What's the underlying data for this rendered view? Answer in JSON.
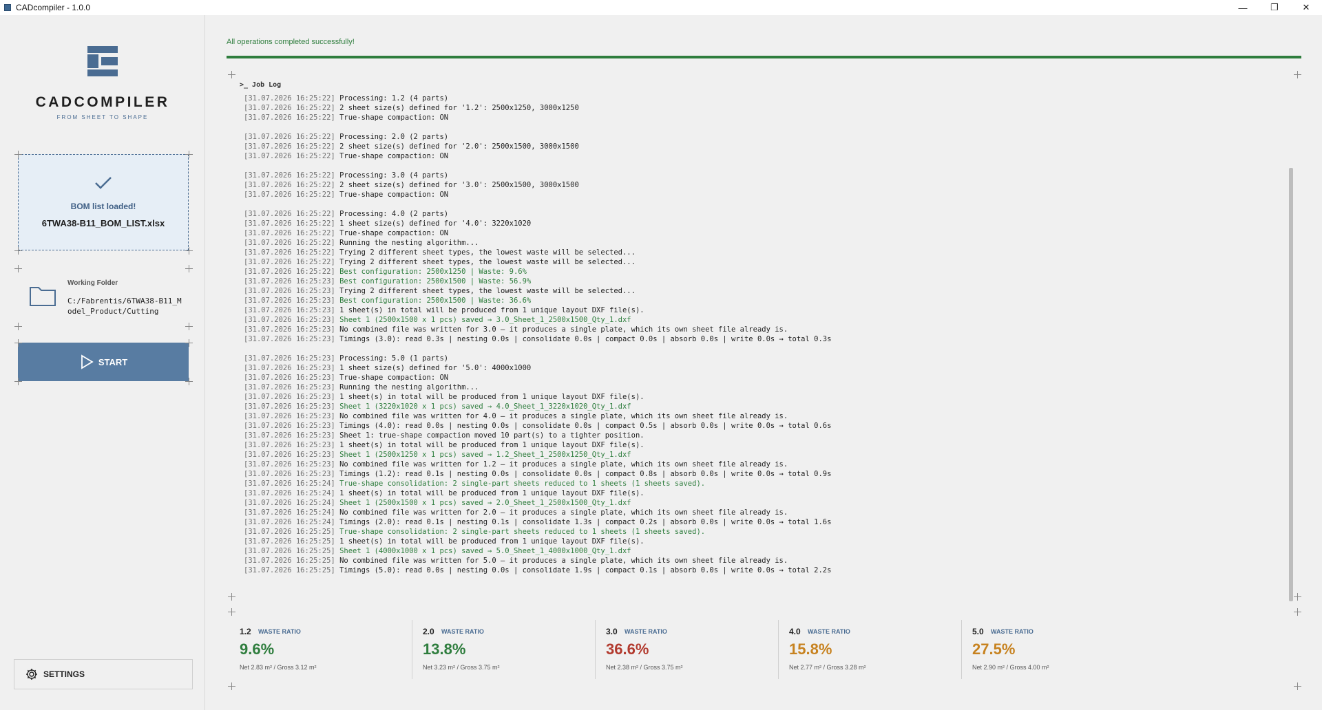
{
  "window": {
    "title": "CADcompiler - 1.0.0",
    "controls": [
      "—",
      "❐",
      "✕"
    ]
  },
  "sidebar": {
    "logo_name": "CADCOMPILER",
    "logo_tagline": "FROM SHEET TO SHAPE",
    "bom_status": "BOM list loaded!",
    "bom_file": "6TWA38-B11_BOM_LIST.xlsx",
    "folder_label": "Working Folder",
    "folder_path": "C:/Fabrentis/6TWA38-B11_Model_Product/Cutting",
    "start_label": "START",
    "settings_label": "SETTINGS"
  },
  "main": {
    "status": "All operations completed successfully!",
    "progress": 1.0,
    "log_title": ">_ Job Log"
  },
  "log": [
    [
      "[31.07.2026 16:25:22]",
      "Processing: 1.2 (4 parts)",
      "n"
    ],
    [
      "[31.07.2026 16:25:22]",
      "2 sheet size(s) defined for '1.2': 2500x1250, 3000x1250",
      "n"
    ],
    [
      "[31.07.2026 16:25:22]",
      "True-shape compaction: ON",
      "n"
    ],
    [
      "",
      "",
      "gap"
    ],
    [
      "[31.07.2026 16:25:22]",
      "Processing: 2.0 (2 parts)",
      "n"
    ],
    [
      "[31.07.2026 16:25:22]",
      "2 sheet size(s) defined for '2.0': 2500x1500, 3000x1500",
      "n"
    ],
    [
      "[31.07.2026 16:25:22]",
      "True-shape compaction: ON",
      "n"
    ],
    [
      "",
      "",
      "gap"
    ],
    [
      "[31.07.2026 16:25:22]",
      "Processing: 3.0 (4 parts)",
      "n"
    ],
    [
      "[31.07.2026 16:25:22]",
      "2 sheet size(s) defined for '3.0': 2500x1500, 3000x1500",
      "n"
    ],
    [
      "[31.07.2026 16:25:22]",
      "True-shape compaction: ON",
      "n"
    ],
    [
      "",
      "",
      "gap"
    ],
    [
      "[31.07.2026 16:25:22]",
      "Processing: 4.0 (2 parts)",
      "n"
    ],
    [
      "[31.07.2026 16:25:22]",
      "1 sheet size(s) defined for '4.0': 3220x1020",
      "n"
    ],
    [
      "[31.07.2026 16:25:22]",
      "True-shape compaction: ON",
      "n"
    ],
    [
      "[31.07.2026 16:25:22]",
      "Running the nesting algorithm...",
      "n"
    ],
    [
      "[31.07.2026 16:25:22]",
      "Trying 2 different sheet types, the lowest waste will be selected...",
      "n"
    ],
    [
      "[31.07.2026 16:25:22]",
      "Trying 2 different sheet types, the lowest waste will be selected...",
      "n"
    ],
    [
      "[31.07.2026 16:25:22]",
      "Best configuration: 2500x1250 | Waste: 9.6%",
      "g"
    ],
    [
      "[31.07.2026 16:25:23]",
      "Best configuration: 2500x1500 | Waste: 56.9%",
      "g"
    ],
    [
      "[31.07.2026 16:25:23]",
      "Trying 2 different sheet types, the lowest waste will be selected...",
      "n"
    ],
    [
      "[31.07.2026 16:25:23]",
      "Best configuration: 2500x1500 | Waste: 36.6%",
      "g"
    ],
    [
      "[31.07.2026 16:25:23]",
      "1 sheet(s) in total will be produced from 1 unique layout DXF file(s).",
      "n"
    ],
    [
      "[31.07.2026 16:25:23]",
      "Sheet 1 (2500x1500 x 1 pcs) saved → 3.0_Sheet_1_2500x1500_Qty_1.dxf",
      "g"
    ],
    [
      "[31.07.2026 16:25:23]",
      "No combined file was written for 3.0 — it produces a single plate, which its own sheet file already is.",
      "n"
    ],
    [
      "[31.07.2026 16:25:23]",
      "Timings (3.0): read 0.3s | nesting 0.0s | consolidate 0.0s | compact 0.0s | absorb 0.0s | write 0.0s → total 0.3s",
      "n"
    ],
    [
      "",
      "",
      "gap"
    ],
    [
      "[31.07.2026 16:25:23]",
      "Processing: 5.0 (1 parts)",
      "n"
    ],
    [
      "[31.07.2026 16:25:23]",
      "1 sheet size(s) defined for '5.0': 4000x1000",
      "n"
    ],
    [
      "[31.07.2026 16:25:23]",
      "True-shape compaction: ON",
      "n"
    ],
    [
      "[31.07.2026 16:25:23]",
      "Running the nesting algorithm...",
      "n"
    ],
    [
      "[31.07.2026 16:25:23]",
      "1 sheet(s) in total will be produced from 1 unique layout DXF file(s).",
      "n"
    ],
    [
      "[31.07.2026 16:25:23]",
      "Sheet 1 (3220x1020 x 1 pcs) saved → 4.0_Sheet_1_3220x1020_Qty_1.dxf",
      "g"
    ],
    [
      "[31.07.2026 16:25:23]",
      "No combined file was written for 4.0 — it produces a single plate, which its own sheet file already is.",
      "n"
    ],
    [
      "[31.07.2026 16:25:23]",
      "Timings (4.0): read 0.0s | nesting 0.0s | consolidate 0.0s | compact 0.5s | absorb 0.0s | write 0.0s → total 0.6s",
      "n"
    ],
    [
      "[31.07.2026 16:25:23]",
      "Sheet 1: true-shape compaction moved 10 part(s) to a tighter position.",
      "n"
    ],
    [
      "[31.07.2026 16:25:23]",
      "1 sheet(s) in total will be produced from 1 unique layout DXF file(s).",
      "n"
    ],
    [
      "[31.07.2026 16:25:23]",
      "Sheet 1 (2500x1250 x 1 pcs) saved → 1.2_Sheet_1_2500x1250_Qty_1.dxf",
      "g"
    ],
    [
      "[31.07.2026 16:25:23]",
      "No combined file was written for 1.2 — it produces a single plate, which its own sheet file already is.",
      "n"
    ],
    [
      "[31.07.2026 16:25:23]",
      "Timings (1.2): read 0.1s | nesting 0.0s | consolidate 0.0s | compact 0.8s | absorb 0.0s | write 0.0s → total 0.9s",
      "n"
    ],
    [
      "[31.07.2026 16:25:24]",
      "True-shape consolidation: 2 single-part sheets reduced to 1 sheets (1 sheets saved).",
      "g"
    ],
    [
      "[31.07.2026 16:25:24]",
      "1 sheet(s) in total will be produced from 1 unique layout DXF file(s).",
      "n"
    ],
    [
      "[31.07.2026 16:25:24]",
      "Sheet 1 (2500x1500 x 1 pcs) saved → 2.0_Sheet_1_2500x1500_Qty_1.dxf",
      "g"
    ],
    [
      "[31.07.2026 16:25:24]",
      "No combined file was written for 2.0 — it produces a single plate, which its own sheet file already is.",
      "n"
    ],
    [
      "[31.07.2026 16:25:24]",
      "Timings (2.0): read 0.1s | nesting 0.1s | consolidate 1.3s | compact 0.2s | absorb 0.0s | write 0.0s → total 1.6s",
      "n"
    ],
    [
      "[31.07.2026 16:25:25]",
      "True-shape consolidation: 2 single-part sheets reduced to 1 sheets (1 sheets saved).",
      "g"
    ],
    [
      "[31.07.2026 16:25:25]",
      "1 sheet(s) in total will be produced from 1 unique layout DXF file(s).",
      "n"
    ],
    [
      "[31.07.2026 16:25:25]",
      "Sheet 1 (4000x1000 x 1 pcs) saved → 5.0_Sheet_1_4000x1000_Qty_1.dxf",
      "g"
    ],
    [
      "[31.07.2026 16:25:25]",
      "No combined file was written for 5.0 — it produces a single plate, which its own sheet file already is.",
      "n"
    ],
    [
      "[31.07.2026 16:25:25]",
      "Timings (5.0): read 0.0s | nesting 0.0s | consolidate 1.9s | compact 0.1s | absorb 0.0s | write 0.0s → total 2.2s",
      "n"
    ]
  ],
  "stats": [
    {
      "key": "1.2",
      "label": "WASTE RATIO",
      "value": "9.6%",
      "color": "#2e7d3d",
      "net": "Net 2.83 m² / Gross 3.12 m²"
    },
    {
      "key": "2.0",
      "label": "WASTE RATIO",
      "value": "13.8%",
      "color": "#2e7d3d",
      "net": "Net 3.23 m² / Gross 3.75 m²"
    },
    {
      "key": "3.0",
      "label": "WASTE RATIO",
      "value": "36.6%",
      "color": "#b23a2e",
      "net": "Net 2.38 m² / Gross 3.75 m²"
    },
    {
      "key": "4.0",
      "label": "WASTE RATIO",
      "value": "15.8%",
      "color": "#c7821f",
      "net": "Net 2.77 m² / Gross 3.28 m²"
    },
    {
      "key": "5.0",
      "label": "WASTE RATIO",
      "value": "27.5%",
      "color": "#c7821f",
      "net": "Net 2.90 m² / Gross 4.00 m²"
    }
  ],
  "colors": {
    "accent": "#4a6c92",
    "success": "#2e7d3d",
    "warning": "#c7821f",
    "danger": "#b23a2e"
  },
  "icons": {
    "check": "check-icon",
    "folder": "folder-icon",
    "play": "play-icon",
    "gear": "gear-icon"
  }
}
